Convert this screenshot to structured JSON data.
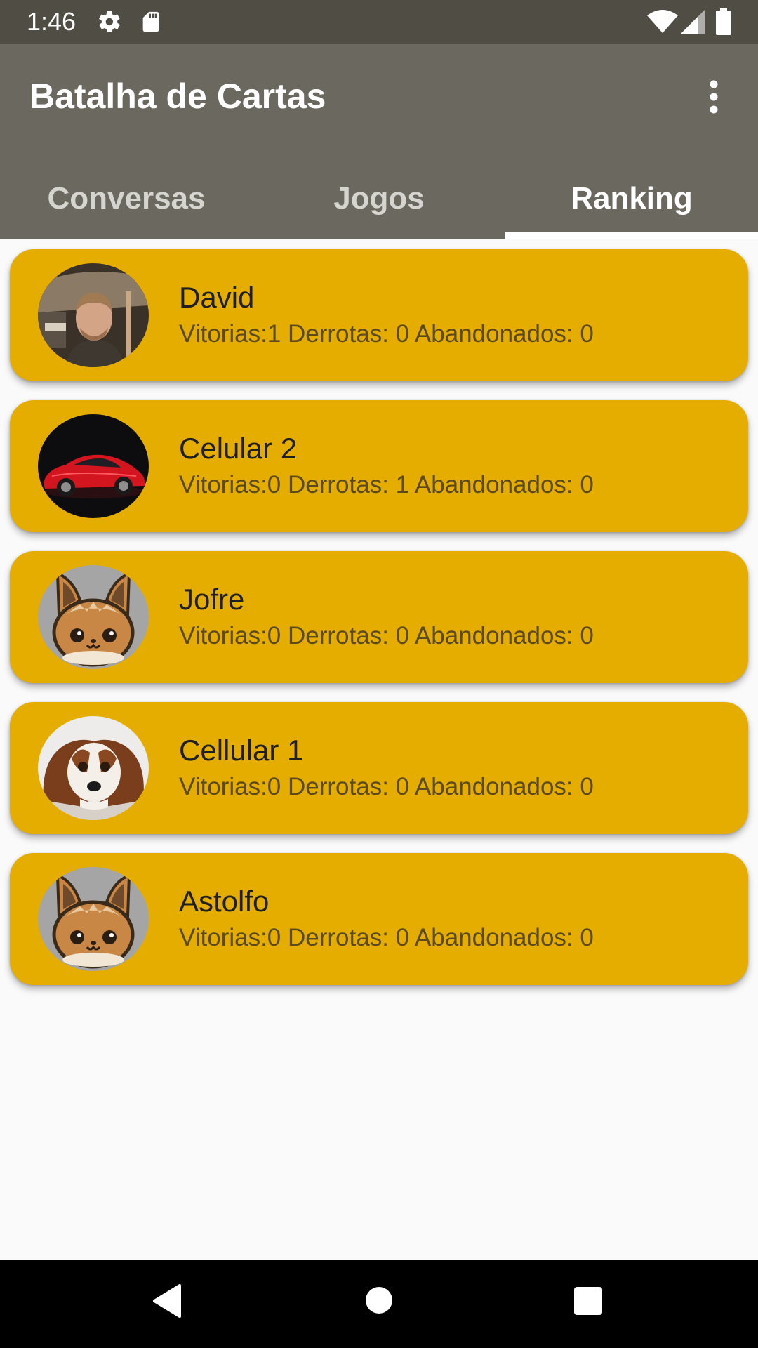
{
  "status_bar": {
    "time": "1:46",
    "icons": [
      "settings-icon",
      "sd-card-icon",
      "wifi-icon",
      "signal-icon",
      "battery-icon"
    ]
  },
  "app_bar": {
    "title": "Batalha de Cartas",
    "menu_icon": "more-vert-icon"
  },
  "tabs": [
    {
      "label": "Conversas",
      "selected": false
    },
    {
      "label": "Jogos",
      "selected": false
    },
    {
      "label": "Ranking",
      "selected": true
    }
  ],
  "ranking": [
    {
      "name": "David",
      "stats": "Vitorias:1 Derrotas: 0 Abandonados: 0",
      "avatar": "man-photo"
    },
    {
      "name": "Celular 2",
      "stats": "Vitorias:0 Derrotas: 1 Abandonados: 0",
      "avatar": "red-car-photo"
    },
    {
      "name": "Jofre",
      "stats": "Vitorias:0 Derrotas: 0 Abandonados: 0",
      "avatar": "cartoon-fox"
    },
    {
      "name": "Cellular 1",
      "stats": "Vitorias:0 Derrotas: 0 Abandonados: 0",
      "avatar": "dog-photo"
    },
    {
      "name": "Astolfo",
      "stats": "Vitorias:0 Derrotas: 0 Abandonados: 0",
      "avatar": "cartoon-fox"
    }
  ],
  "nav_bar": {
    "buttons": [
      "back-icon",
      "home-icon",
      "recents-icon"
    ]
  },
  "colors": {
    "status_bar": "#504d45",
    "app_bar": "#6b695f",
    "card": "#e5ad00",
    "background": "#fafafa",
    "nav_bar": "#000000"
  }
}
